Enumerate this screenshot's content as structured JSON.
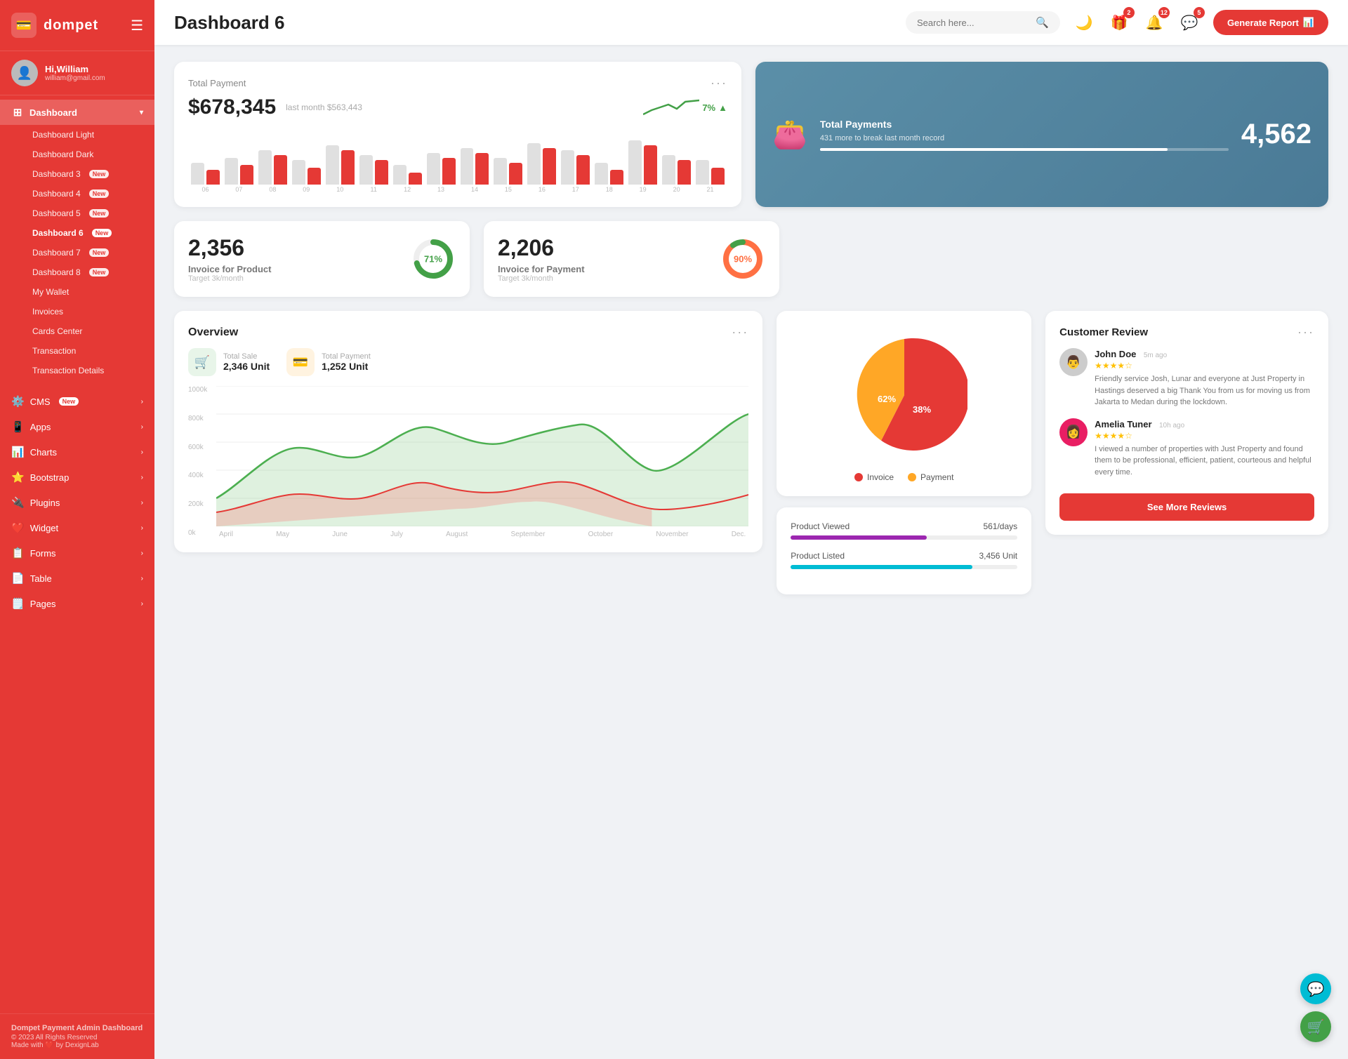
{
  "app": {
    "name": "dompet",
    "logo_icon": "💳"
  },
  "user": {
    "greeting": "Hi,William",
    "email": "william@gmail.com",
    "avatar": "👤"
  },
  "sidebar": {
    "dashboard_label": "Dashboard",
    "items": [
      {
        "label": "Dashboard Light",
        "active": false
      },
      {
        "label": "Dashboard Dark",
        "active": false
      },
      {
        "label": "Dashboard 3",
        "active": false,
        "badge": "New"
      },
      {
        "label": "Dashboard 4",
        "active": false,
        "badge": "New"
      },
      {
        "label": "Dashboard 5",
        "active": false,
        "badge": "New"
      },
      {
        "label": "Dashboard 6",
        "active": true,
        "badge": "New"
      },
      {
        "label": "Dashboard 7",
        "active": false,
        "badge": "New"
      },
      {
        "label": "Dashboard 8",
        "active": false,
        "badge": "New"
      },
      {
        "label": "My Wallet",
        "active": false
      },
      {
        "label": "Invoices",
        "active": false
      },
      {
        "label": "Cards Center",
        "active": false
      },
      {
        "label": "Transaction",
        "active": false
      },
      {
        "label": "Transaction Details",
        "active": false
      }
    ],
    "menu": [
      {
        "label": "CMS",
        "badge": "New",
        "icon": "⚙️"
      },
      {
        "label": "Apps",
        "icon": "📱"
      },
      {
        "label": "Charts",
        "icon": "📊"
      },
      {
        "label": "Bootstrap",
        "icon": "⭐"
      },
      {
        "label": "Plugins",
        "icon": "🔌"
      },
      {
        "label": "Widget",
        "icon": "❤️"
      },
      {
        "label": "Forms",
        "icon": "📋"
      },
      {
        "label": "Table",
        "icon": "📄"
      },
      {
        "label": "Pages",
        "icon": "🗒️"
      }
    ],
    "footer": {
      "app_name": "Dompet Payment Admin Dashboard",
      "copyright": "© 2023 All Rights Reserved",
      "made_with": "Made with ❤️ by DexignLab"
    }
  },
  "topbar": {
    "title": "Dashboard 6",
    "search_placeholder": "Search here...",
    "generate_btn": "Generate Report",
    "notifications": [
      {
        "count": 2
      },
      {
        "count": 12
      },
      {
        "count": 5
      }
    ]
  },
  "total_payment": {
    "label": "Total Payment",
    "amount": "$678,345",
    "last_month_label": "last month $563,443",
    "trend": "7%",
    "bars": [
      {
        "gray": 45,
        "red": 30
      },
      {
        "gray": 55,
        "red": 40
      },
      {
        "gray": 70,
        "red": 60
      },
      {
        "gray": 50,
        "red": 35
      },
      {
        "gray": 80,
        "red": 70
      },
      {
        "gray": 60,
        "red": 50
      },
      {
        "gray": 40,
        "red": 25
      },
      {
        "gray": 65,
        "red": 55
      },
      {
        "gray": 75,
        "red": 65
      },
      {
        "gray": 55,
        "red": 45
      },
      {
        "gray": 85,
        "red": 75
      },
      {
        "gray": 70,
        "red": 60
      },
      {
        "gray": 45,
        "red": 30
      },
      {
        "gray": 90,
        "red": 80
      },
      {
        "gray": 60,
        "red": 50
      },
      {
        "gray": 50,
        "red": 35
      }
    ],
    "chart_labels": [
      "06",
      "07",
      "08",
      "09",
      "10",
      "11",
      "12",
      "13",
      "14",
      "15",
      "16",
      "17",
      "18",
      "19",
      "20",
      "21"
    ]
  },
  "total_payments_blue": {
    "title": "Total Payments",
    "subtitle": "431 more to break last month record",
    "count": "4,562",
    "progress": 85
  },
  "invoice_product": {
    "number": "2,356",
    "label": "Invoice for Product",
    "target": "Target 3k/month",
    "percent": 71,
    "color": "#43a047"
  },
  "invoice_payment": {
    "number": "2,206",
    "label": "Invoice for Payment",
    "target": "Target 3k/month",
    "percent": 90,
    "color": "#ff7043"
  },
  "overview": {
    "title": "Overview",
    "total_sale": {
      "label": "Total Sale",
      "value": "2,346 Unit"
    },
    "total_payment": {
      "label": "Total Payment",
      "value": "1,252 Unit"
    },
    "y_labels": [
      "1000k",
      "800k",
      "600k",
      "400k",
      "200k",
      "0k"
    ],
    "x_labels": [
      "April",
      "May",
      "June",
      "July",
      "August",
      "September",
      "October",
      "November",
      "Dec."
    ]
  },
  "pie_chart": {
    "invoice_pct": 62,
    "payment_pct": 38,
    "invoice_label": "Invoice",
    "payment_label": "Payment",
    "invoice_color": "#e53935",
    "payment_color": "#ffa726"
  },
  "product_stats": [
    {
      "label": "Product Viewed",
      "value": "561/days",
      "progress": 60,
      "color": "purple"
    },
    {
      "label": "Product Listed",
      "value": "3,456 Unit",
      "progress": 80,
      "color": "teal"
    }
  ],
  "reviews": {
    "title": "Customer Review",
    "items": [
      {
        "name": "John Doe",
        "stars": 4,
        "time": "5m ago",
        "text": "Friendly service Josh, Lunar and everyone at Just Property in Hastings deserved a big Thank You from us for moving us from Jakarta to Medan during the lockdown.",
        "avatar": "👨"
      },
      {
        "name": "Amelia Tuner",
        "stars": 4,
        "time": "10h ago",
        "text": "I viewed a number of properties with Just Property and found them to be professional, efficient, patient, courteous and helpful every time.",
        "avatar": "👩"
      }
    ],
    "see_more_btn": "See More Reviews"
  },
  "fab": {
    "support_icon": "💬",
    "cart_icon": "🛒"
  }
}
